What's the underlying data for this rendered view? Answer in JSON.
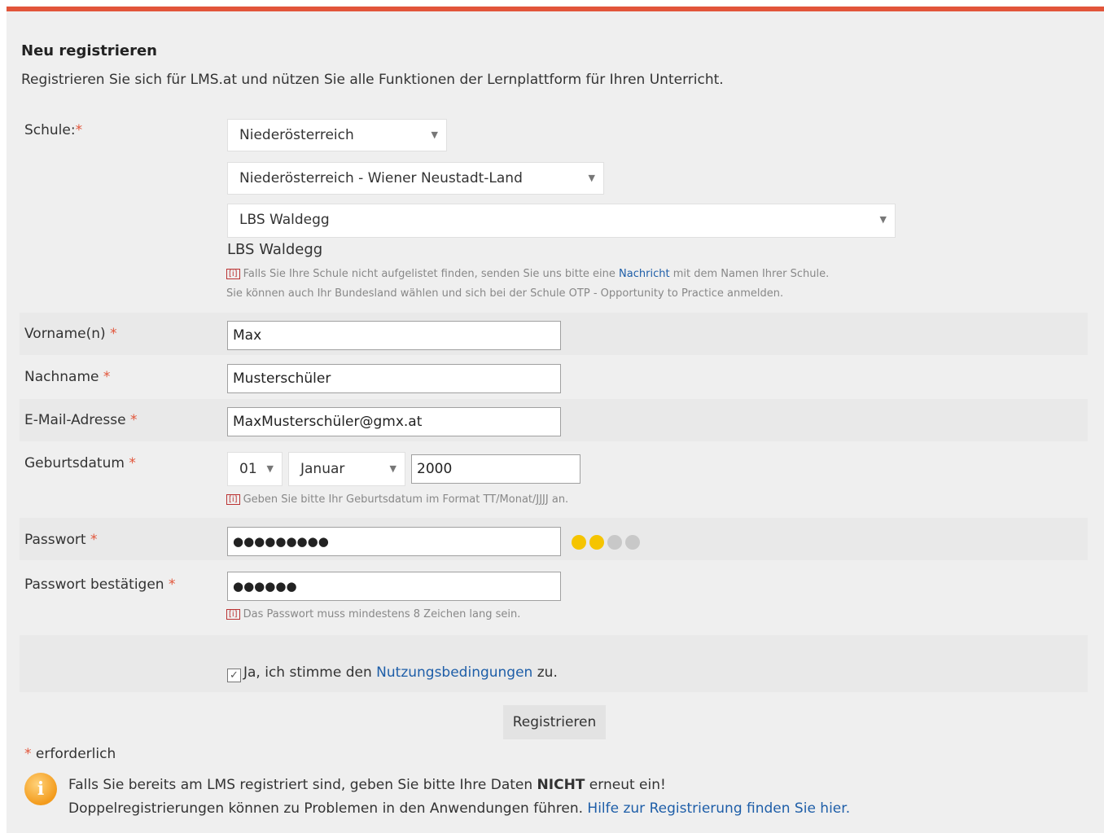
{
  "form": {
    "title": "Neu registrieren",
    "subtitle": "Registrieren Sie sich für LMS.at und nützen Sie alle Funktionen der Lernplattform für Ihren Unterricht.",
    "required_marker": "*",
    "school": {
      "label": "Schule:",
      "state_select": "Niederösterreich",
      "district_select": "Niederösterreich - Wiener Neustadt-Land",
      "school_select": "LBS Waldegg",
      "selected_text": "LBS Waldegg",
      "hint_icon": "[i]",
      "hint_line1_before": "Falls Sie Ihre Schule nicht aufgelistet finden, senden Sie uns bitte eine ",
      "hint_link": "Nachricht",
      "hint_line1_after": " mit dem Namen Ihrer Schule.",
      "hint_line2": "Sie können auch Ihr Bundesland wählen und sich bei der Schule OTP - Opportunity to Practice anmelden."
    },
    "firstname": {
      "label": "Vorname(n)",
      "value": "Max"
    },
    "lastname": {
      "label": "Nachname",
      "value": "Musterschüler"
    },
    "email": {
      "label": "E-Mail-Adresse",
      "value": "MaxMusterschüler@gmx.at"
    },
    "birthdate": {
      "label": "Geburtsdatum",
      "day": "01",
      "month": "Januar",
      "year": "2000",
      "hint": "Geben Sie bitte Ihr Geburtsdatum im Format TT/Monat/JJJJ an."
    },
    "password": {
      "label": "Passwort",
      "value": "●●●●●●●●●",
      "strength_level": 2,
      "strength_max": 4
    },
    "password_confirm": {
      "label": "Passwort bestätigen",
      "value": "●●●●●●",
      "hint": "Das Passwort muss mindestens 8 Zeichen lang sein."
    },
    "terms": {
      "before": "Ja, ich stimme den ",
      "link": "Nutzungsbedingungen",
      "after": " zu.",
      "checked": true
    },
    "submit_label": "Registrieren",
    "required_note": "erforderlich"
  },
  "notice": {
    "line1_before": "Falls Sie bereits am LMS registriert sind, geben Sie bitte Ihre Daten ",
    "line1_bold": "NICHT",
    "line1_after": " erneut ein!",
    "line2_before": "Doppelregistrierungen können zu Problemen in den Anwendungen führen. ",
    "line2_link": "Hilfe zur Registrierung finden Sie hier."
  },
  "colors": {
    "accent": "#e2553a",
    "link": "#1e5ea8",
    "strength_on": "#f5c400",
    "strength_off": "#c8c8c8"
  }
}
